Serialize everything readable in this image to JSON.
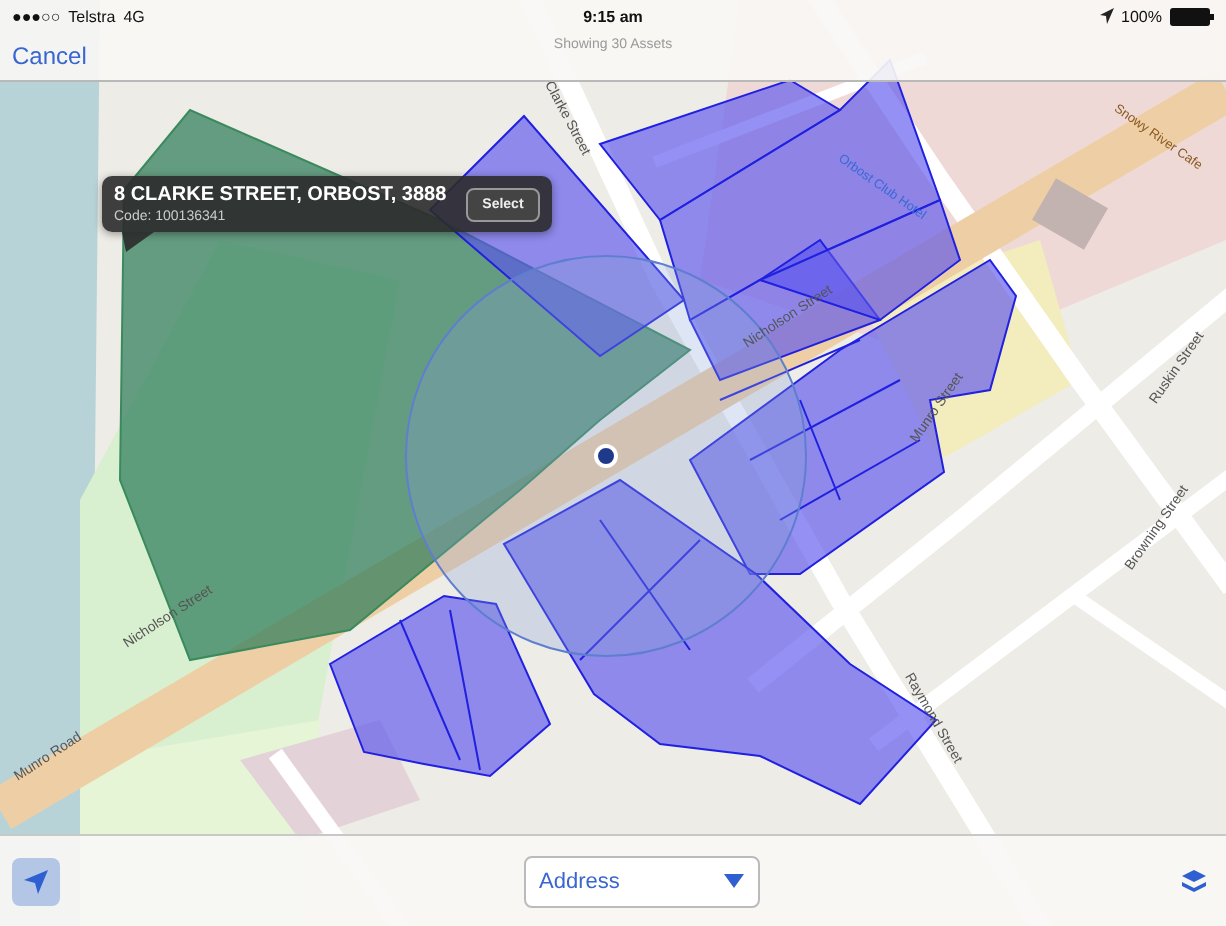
{
  "status_bar": {
    "signal": "●●●○○",
    "carrier": "Telstra",
    "network": "4G",
    "time": "9:15 am",
    "battery": "100%"
  },
  "nav_bar": {
    "cancel": "Cancel",
    "subtitle": "Showing 30 Assets"
  },
  "map": {
    "street_labels": [
      {
        "text": "Clarke Street"
      },
      {
        "text": "Nicholson Street"
      },
      {
        "text": "Nicholson Street"
      },
      {
        "text": "Munro Street"
      },
      {
        "text": "Raymond Street"
      },
      {
        "text": "Ruskin Street"
      },
      {
        "text": "Browning Street"
      },
      {
        "text": "Munro Road"
      }
    ],
    "place_labels": [
      {
        "text": "Snowy River Cafe"
      },
      {
        "text": "Orbost Club Hotel"
      }
    ]
  },
  "callout": {
    "title": "8 CLARKE STREET, ORBOST, 3888",
    "code": "Code: 100136341",
    "button": "Select"
  },
  "toolbar": {
    "search_type": "Address"
  }
}
